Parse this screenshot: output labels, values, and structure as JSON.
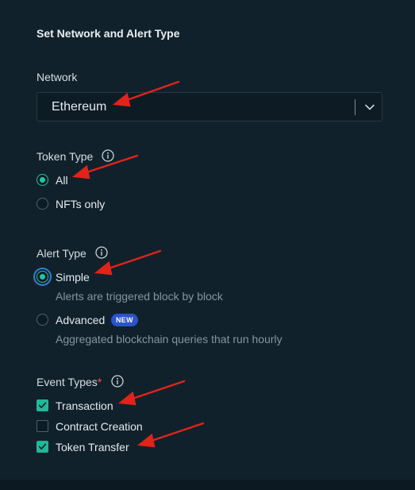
{
  "section_title": "Set Network and Alert Type",
  "network": {
    "label": "Network",
    "selected": "Ethereum"
  },
  "token_type": {
    "label": "Token Type",
    "options": [
      {
        "label": "All",
        "checked": true
      },
      {
        "label": "NFTs only",
        "checked": false
      }
    ]
  },
  "alert_type": {
    "label": "Alert Type",
    "options": [
      {
        "label": "Simple",
        "description": "Alerts are triggered block by block",
        "checked": true
      },
      {
        "label": "Advanced",
        "badge": "NEW",
        "description": "Aggregated blockchain queries that run hourly",
        "checked": false
      }
    ]
  },
  "event_types": {
    "label": "Event Types",
    "required_marker": "*",
    "options": [
      {
        "label": "Transaction",
        "checked": true
      },
      {
        "label": "Contract Creation",
        "checked": false
      },
      {
        "label": "Token Transfer",
        "checked": true
      }
    ]
  },
  "colors": {
    "accent": "#1fc7a4",
    "badge": "#2a54c7",
    "annotation_arrow": "#e2231a"
  }
}
